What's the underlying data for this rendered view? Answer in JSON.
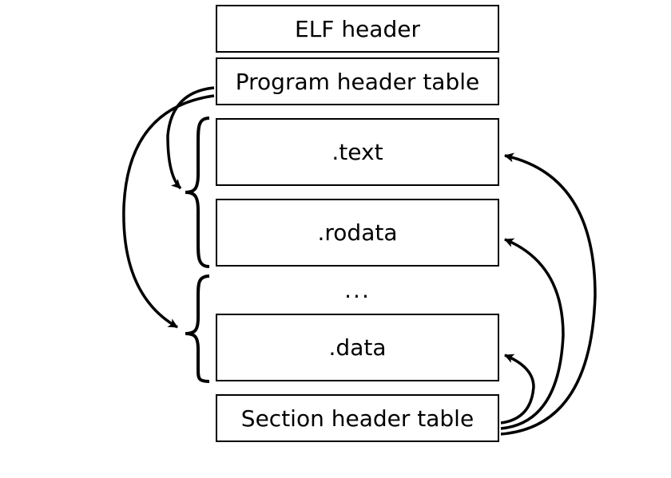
{
  "diagram": {
    "boxes": {
      "elf_header": "ELF header",
      "program_header_table": "Program header table",
      "text_section": ".text",
      "rodata_section": ".rodata",
      "ellipsis": "...",
      "data_section": ".data",
      "section_header_table": "Section header table"
    }
  }
}
